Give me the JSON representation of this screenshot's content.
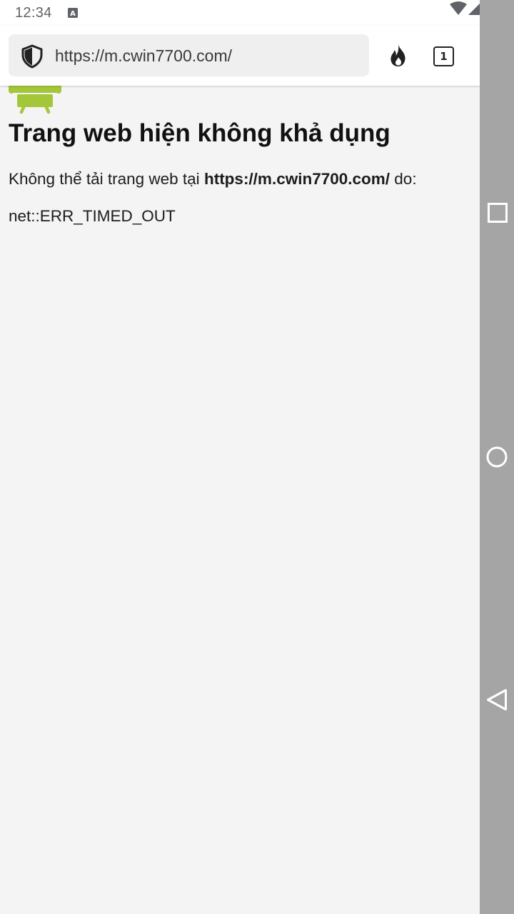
{
  "status_bar": {
    "time": "12:34",
    "notification_icon": "A",
    "icons": [
      "wifi-icon",
      "signal-icon",
      "battery-charging-icon"
    ]
  },
  "toolbar": {
    "url": "https://m.cwin7700.com/",
    "tab_count": "1",
    "icons": [
      "shield-icon",
      "fire-icon",
      "tabs-icon",
      "overflow-menu-icon"
    ]
  },
  "error_page": {
    "title": "Trang web hiện không khả dụng",
    "message_prefix": "Không thể tải trang web tại",
    "message_url": "https://m.cwin7700.com/",
    "message_suffix": "do:",
    "error_code": "net::ERR_TIMED_OUT"
  },
  "nav_bar": {
    "icons": [
      "recents-icon",
      "home-icon",
      "back-icon"
    ]
  },
  "colors": {
    "android_green": "#a4c639",
    "page_background": "#f4f4f4",
    "nav_bar": "#a5a5a5"
  }
}
